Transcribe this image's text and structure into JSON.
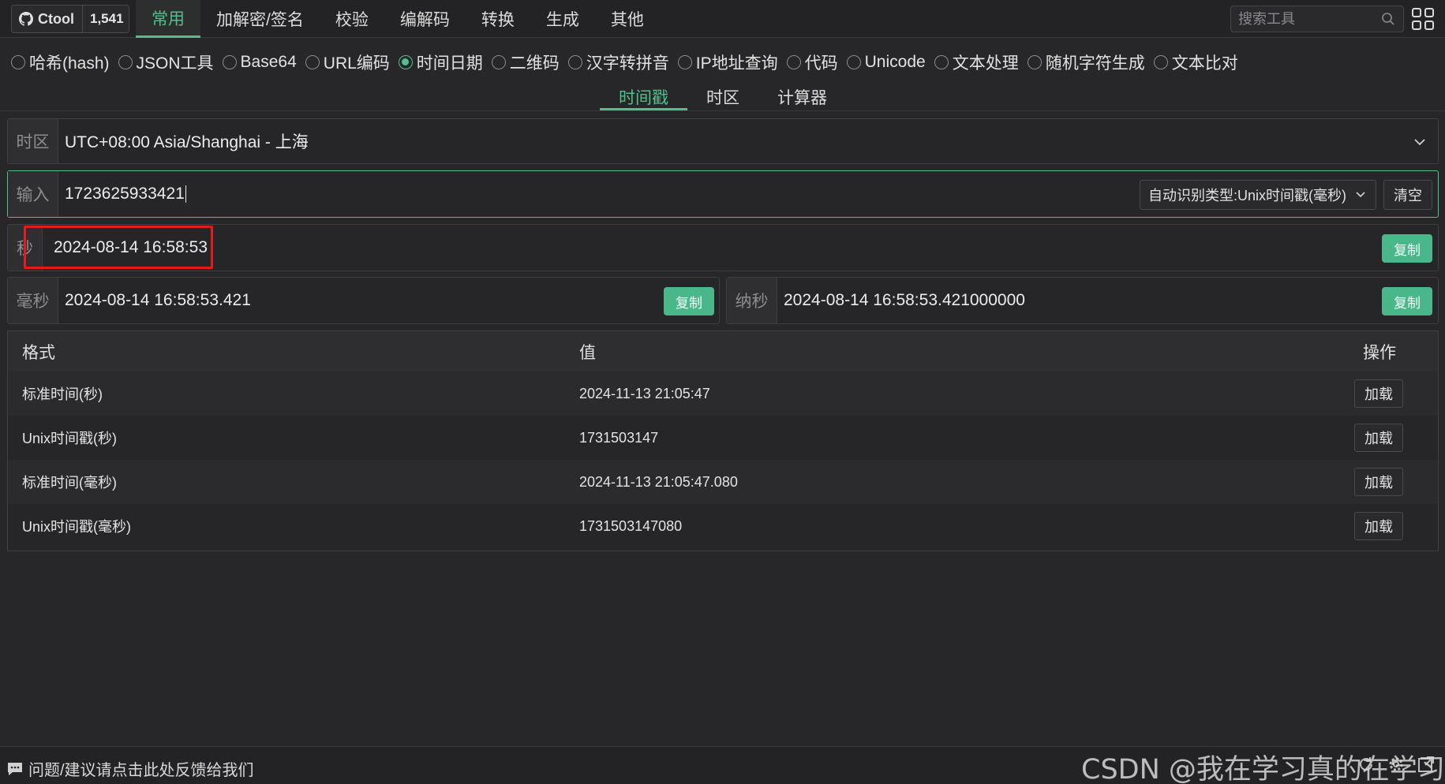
{
  "header": {
    "app_name": "Ctool",
    "star_count": "1,541",
    "nav_tabs": [
      {
        "label": "常用",
        "active": true
      },
      {
        "label": "加解密/签名",
        "active": false
      },
      {
        "label": "校验",
        "active": false
      },
      {
        "label": "编解码",
        "active": false
      },
      {
        "label": "转换",
        "active": false
      },
      {
        "label": "生成",
        "active": false
      },
      {
        "label": "其他",
        "active": false
      }
    ],
    "search_placeholder": "搜索工具"
  },
  "tools": [
    {
      "label": "哈希(hash)",
      "checked": false
    },
    {
      "label": "JSON工具",
      "checked": false
    },
    {
      "label": "Base64",
      "checked": false
    },
    {
      "label": "URL编码",
      "checked": false
    },
    {
      "label": "时间日期",
      "checked": true
    },
    {
      "label": "二维码",
      "checked": false
    },
    {
      "label": "汉字转拼音",
      "checked": false
    },
    {
      "label": "IP地址查询",
      "checked": false
    },
    {
      "label": "代码",
      "checked": false
    },
    {
      "label": "Unicode",
      "checked": false
    },
    {
      "label": "文本处理",
      "checked": false
    },
    {
      "label": "随机字符生成",
      "checked": false
    },
    {
      "label": "文本比对",
      "checked": false
    }
  ],
  "sub_tabs": [
    {
      "label": "时间戳",
      "active": true
    },
    {
      "label": "时区",
      "active": false
    },
    {
      "label": "计算器",
      "active": false
    }
  ],
  "timezone": {
    "prefix": "时区",
    "value": "UTC+08:00 Asia/Shanghai - 上海"
  },
  "input": {
    "prefix": "输入",
    "value": "1723625933421",
    "type_select": "自动识别类型:Unix时间戳(毫秒)",
    "clear_label": "清空"
  },
  "results": {
    "second": {
      "prefix": "秒",
      "value": "2024-08-14 16:58:53",
      "copy_label": "复制"
    },
    "millisecond": {
      "prefix": "毫秒",
      "value": "2024-08-14 16:58:53.421",
      "copy_label": "复制"
    },
    "nanosecond": {
      "prefix": "纳秒",
      "value": "2024-08-14 16:58:53.421000000",
      "copy_label": "复制"
    }
  },
  "table": {
    "headers": {
      "format": "格式",
      "value": "值",
      "action": "操作"
    },
    "rows": [
      {
        "format": "标准时间(秒)",
        "value": "2024-11-13 21:05:47",
        "action": "加载"
      },
      {
        "format": "Unix时间戳(秒)",
        "value": "1731503147",
        "action": "加载"
      },
      {
        "format": "标准时间(毫秒)",
        "value": "2024-11-13 21:05:47.080",
        "action": "加载"
      },
      {
        "format": "Unix时间戳(毫秒)",
        "value": "1731503147080",
        "action": "加载"
      }
    ]
  },
  "footer": {
    "feedback": "问题/建议请点击此处反馈给我们",
    "watermark": "CSDN @我在学习真的在学习"
  },
  "colors": {
    "accent": "#4fc08d",
    "copy_button": "#49b78a",
    "highlight": "#e31b1b",
    "background": "#272729"
  }
}
